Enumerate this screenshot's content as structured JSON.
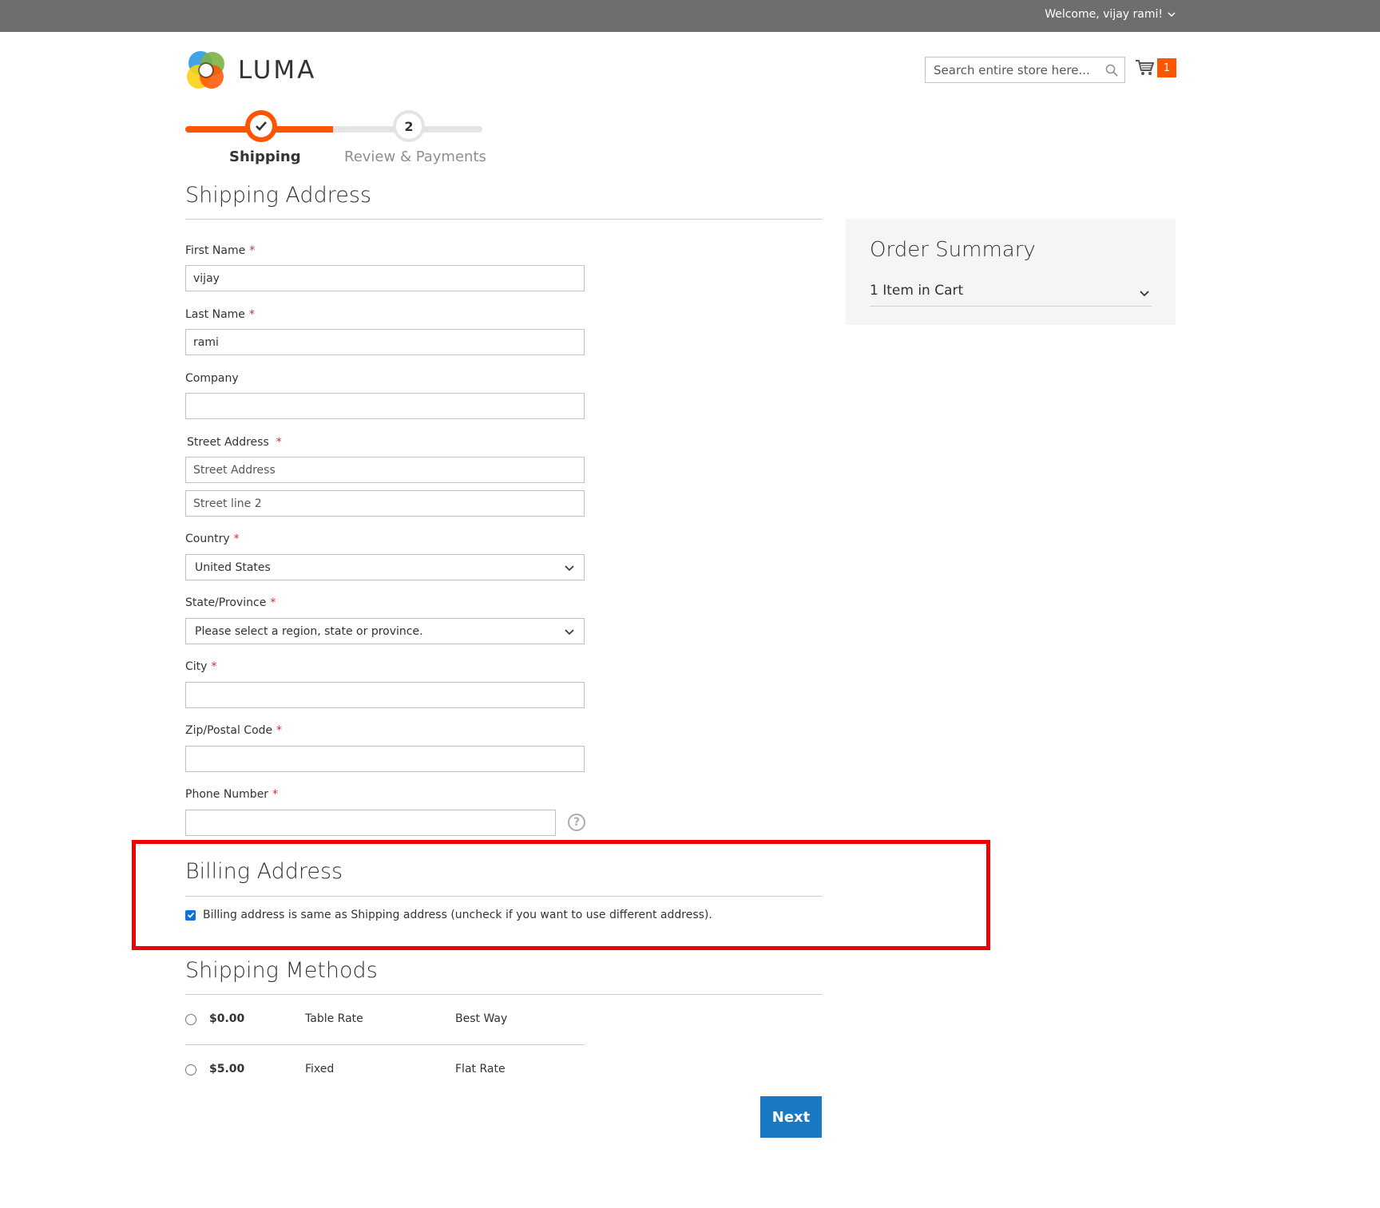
{
  "header": {
    "welcome_text": "Welcome, vijay rami!",
    "logo_text": "LUMA",
    "search_placeholder": "Search entire store here...",
    "cart_count": "1"
  },
  "progress": {
    "steps": [
      {
        "label": "Shipping",
        "state": "completed"
      },
      {
        "label": "Review & Payments",
        "number": "2",
        "state": "pending"
      }
    ]
  },
  "shipping_address": {
    "title": "Shipping Address",
    "fields": {
      "first_name": {
        "label": "First Name",
        "value": "vijay"
      },
      "last_name": {
        "label": "Last Name",
        "value": "rami"
      },
      "company": {
        "label": "Company",
        "value": ""
      },
      "street": {
        "label": "Street Address",
        "line1_placeholder": "Street Address",
        "line2_placeholder": "Street line 2"
      },
      "country": {
        "label": "Country",
        "value": "United States"
      },
      "state": {
        "label": "State/Province",
        "value": "Please select a region, state or province."
      },
      "city": {
        "label": "City",
        "value": ""
      },
      "zip": {
        "label": "Zip/Postal Code",
        "value": ""
      },
      "phone": {
        "label": "Phone Number",
        "value": ""
      }
    },
    "required_marker": "*"
  },
  "billing_address": {
    "title": "Billing Address",
    "same_as_shipping_label": "Billing address is same as Shipping address (uncheck if you want to use different address).",
    "same_as_shipping_checked": true
  },
  "shipping_methods": {
    "title": "Shipping Methods",
    "rows": [
      {
        "price": "$0.00",
        "method": "Table Rate",
        "carrier": "Best Way"
      },
      {
        "price": "$5.00",
        "method": "Fixed",
        "carrier": "Flat Rate"
      }
    ]
  },
  "actions": {
    "next_label": "Next"
  },
  "order_summary": {
    "title": "Order Summary",
    "items_label": "1 Item in Cart"
  },
  "colors": {
    "accent": "#ff5501",
    "primary_button": "#1979c3",
    "highlight_border": "#f20000",
    "topbar": "#6e6e6c"
  }
}
